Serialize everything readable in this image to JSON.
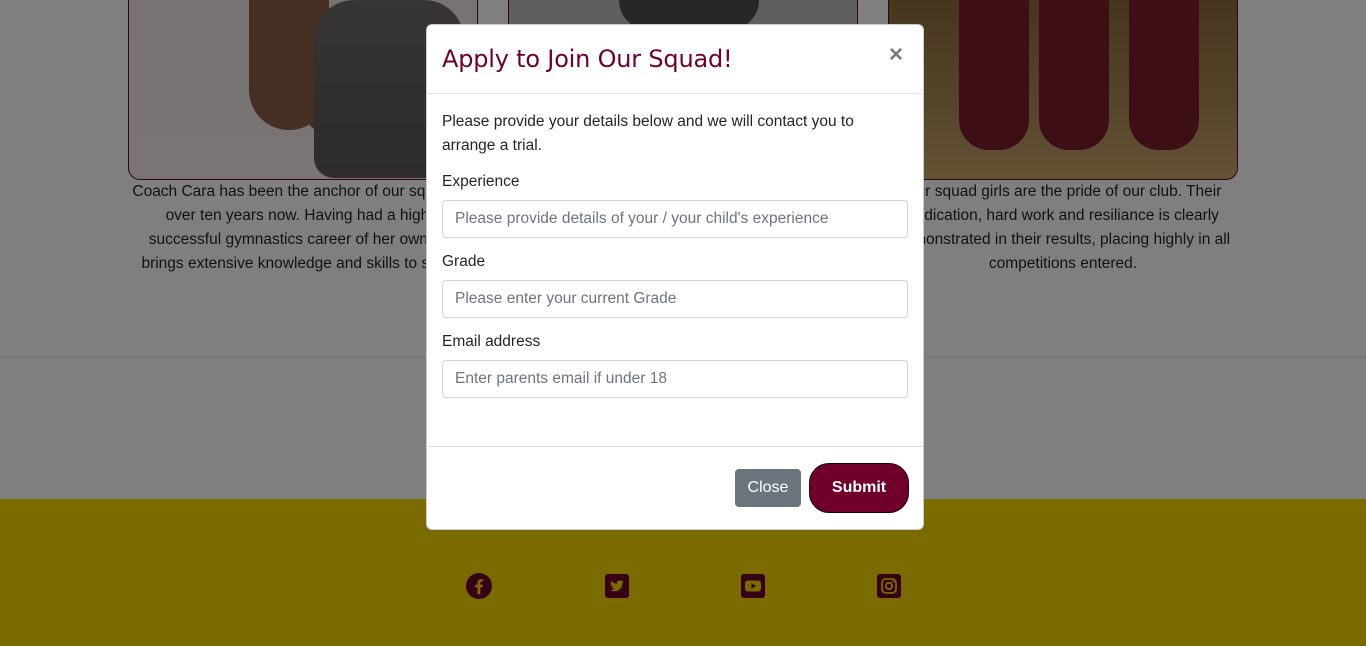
{
  "colors": {
    "brand": "#70002b",
    "footer": "#f2d700",
    "close_button": "#6c757d"
  },
  "cards": [
    {
      "text": "Coach Cara has been the anchor of our squad for over ten years now. Having had a highly successful gymnastics career of her own she brings extensive knowledge and skills to share."
    },
    {
      "text": ""
    },
    {
      "text": "Our squad girls are the pride of our club. Their dedication, hard work and resiliance is clearly demonstrated in their results, placing highly in all competitions entered."
    }
  ],
  "modal": {
    "title": "Apply to Join Our Squad!",
    "close_symbol": "×",
    "intro": "Please provide your details below and we will contact you to arrange a trial.",
    "fields": [
      {
        "label": "Experience",
        "placeholder": "Please provide details of your / your child's experience",
        "value": ""
      },
      {
        "label": "Grade",
        "placeholder": "Please enter your current Grade",
        "value": ""
      },
      {
        "label": "Email address",
        "placeholder": "Enter parents email if under 18",
        "value": ""
      }
    ],
    "close_button": "Close",
    "submit_button": "Submit"
  },
  "social_icons": [
    "facebook-icon",
    "twitter-icon",
    "youtube-icon",
    "instagram-icon"
  ]
}
